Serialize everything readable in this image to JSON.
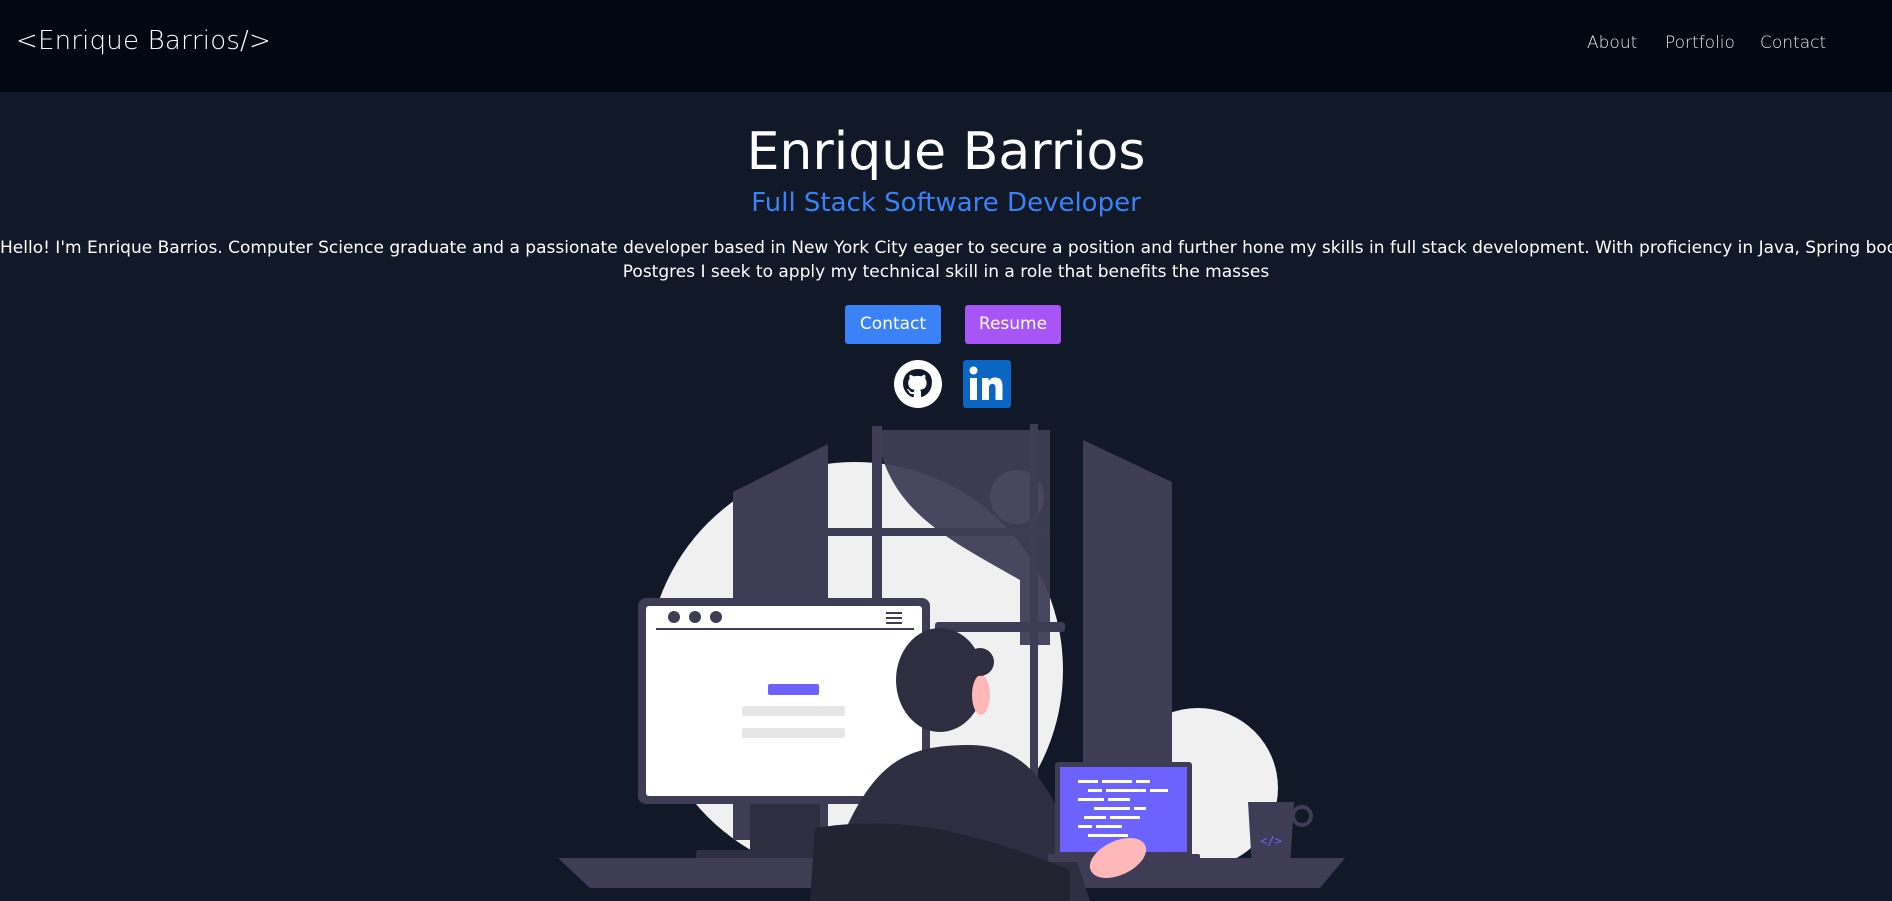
{
  "navbar": {
    "brand": "<Enrique Barrios/>",
    "links": [
      "About",
      "Portfolio",
      "Contact"
    ]
  },
  "hero": {
    "title": "Enrique Barrios",
    "subtitle": "Full Stack Software Developer",
    "description_line1": "Hello! I'm Enrique Barrios. Computer Science graduate and a passionate developer based in New York City eager to secure a position and further hone my skills in full stack development. With proficiency in Java, Spring boot, C#, React, AWS, And",
    "description_line2": "Postgres I seek to apply my technical skill in a role that benefits the masses",
    "buttons": {
      "contact": "Contact",
      "resume": "Resume"
    },
    "social_icons": [
      "github-icon",
      "linkedin-icon"
    ]
  },
  "colors": {
    "page_bg": "#111827",
    "navbar_bg": "#030712",
    "subtitle_blue": "#3b82f6",
    "contact_button": "#3b82f6",
    "resume_button": "#a855f7",
    "linkedin_blue": "#0a66c2",
    "accent_purple": "#6c63ff"
  }
}
